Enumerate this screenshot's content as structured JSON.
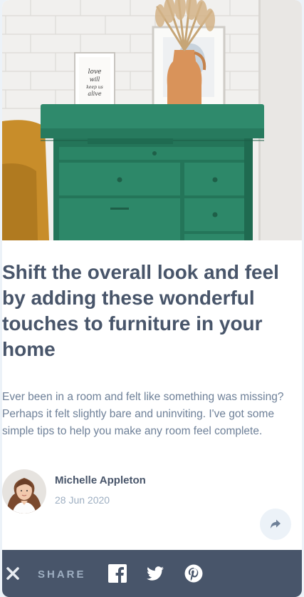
{
  "article": {
    "title": "Shift the overall look and feel by adding these wonderful touches to furniture in your home",
    "excerpt": "Ever been in a room and felt like something was missing? Perhaps it felt slightly bare and uninviting. I've got some simple tips to help you make any room feel complete.",
    "image_alt": "Green wooden drawer with a vase and picture frames",
    "frame_text": "love will keep us alive"
  },
  "author": {
    "name": "Michelle Appleton",
    "date": "28 Jun 2020",
    "avatar_icon": "avatar-portrait"
  },
  "share": {
    "label": "SHARE",
    "close_icon": "close-icon",
    "toggle_icon": "share-arrow-icon",
    "networks": [
      {
        "name": "Facebook",
        "icon": "facebook-icon"
      },
      {
        "name": "Twitter",
        "icon": "twitter-icon"
      },
      {
        "name": "Pinterest",
        "icon": "pinterest-icon"
      }
    ]
  },
  "colors": {
    "title": "#48556a",
    "body": "#6e8098",
    "muted": "#9eafc2",
    "share_bar": "#48556a",
    "background": "#ecf2f8"
  }
}
